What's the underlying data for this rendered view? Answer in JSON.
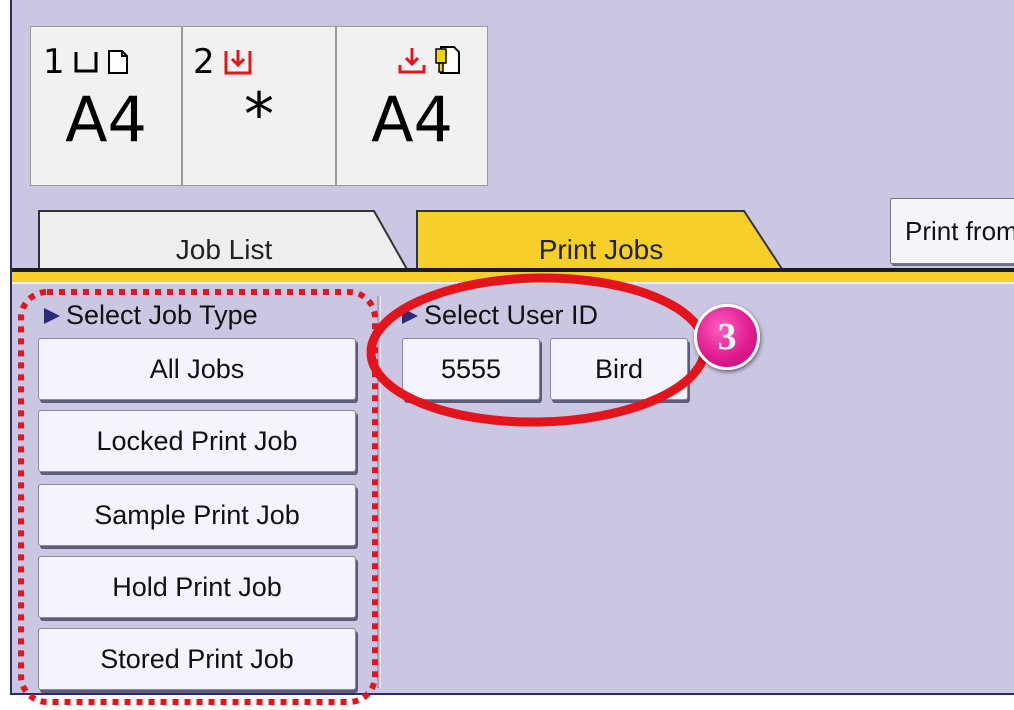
{
  "trays": [
    {
      "number": "1",
      "size": "A4"
    },
    {
      "number": "2",
      "size": "*"
    },
    {
      "number": "",
      "size": "A4"
    }
  ],
  "tabs": [
    {
      "label": "Job List",
      "active": false
    },
    {
      "label": "Print Jobs",
      "active": true
    }
  ],
  "print_from_label": "Print from",
  "job_type": {
    "title": "Select Job Type",
    "buttons": [
      "All Jobs",
      "Locked Print Job",
      "Sample Print Job",
      "Hold Print Job",
      "Stored Print Job"
    ]
  },
  "user_id": {
    "title": "Select User ID",
    "buttons": [
      "5555",
      "Bird"
    ]
  },
  "step_badge": "3",
  "colors": {
    "background": "#c9c7e2",
    "active_tab": "#f7cf2a",
    "annotation_red": "#e3141b",
    "badge_pink": "#e01c8f"
  }
}
